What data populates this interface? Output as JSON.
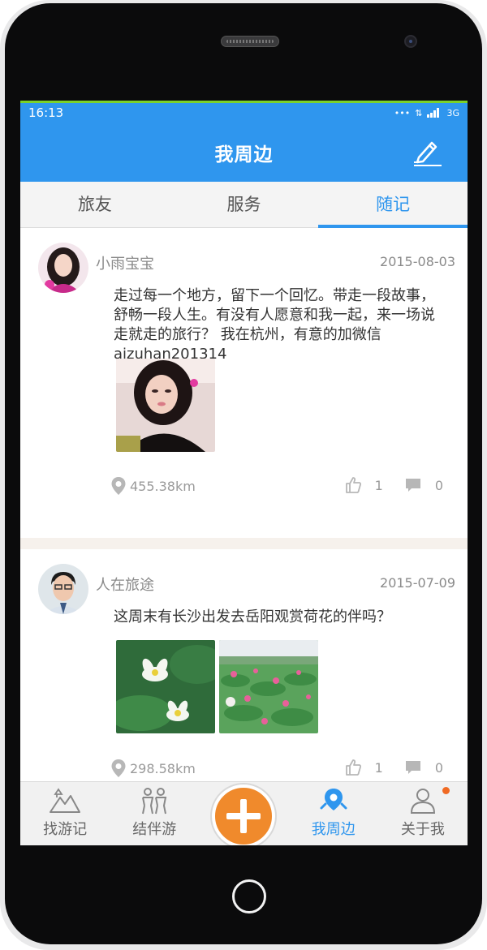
{
  "status_bar": {
    "time": "16:13",
    "network": "3G"
  },
  "header": {
    "title": "我周边"
  },
  "tabs": [
    {
      "label": "旅友",
      "active": false
    },
    {
      "label": "服务",
      "active": false
    },
    {
      "label": "随记",
      "active": true
    }
  ],
  "posts": [
    {
      "username": "小雨宝宝",
      "date": "2015-08-03",
      "content": "走过每一个地方，留下一个回忆。带走一段故事，舒畅一段人生。有没有人愿意和我一起，来一场说走就走的旅行？ 我在杭州，有意的加微信aizuhan201314",
      "distance": "455.38km",
      "likes": "1",
      "comments": "0"
    },
    {
      "username": "人在旅途",
      "date": "2015-07-09",
      "content": "这周末有长沙出发去岳阳观赏荷花的伴吗？",
      "distance": "298.58km",
      "likes": "1",
      "comments": "0"
    }
  ],
  "bottom_nav": [
    {
      "label": "找游记",
      "icon": "mountain-icon"
    },
    {
      "label": "结伴游",
      "icon": "group-icon"
    },
    {
      "label": "",
      "icon": "plus-icon"
    },
    {
      "label": "我周边",
      "icon": "nearby-icon",
      "active": true
    },
    {
      "label": "关于我",
      "icon": "user-icon"
    }
  ],
  "colors": {
    "accent": "#2f96ee",
    "plus_button": "#f08a2c",
    "badge": "#f06a23"
  }
}
